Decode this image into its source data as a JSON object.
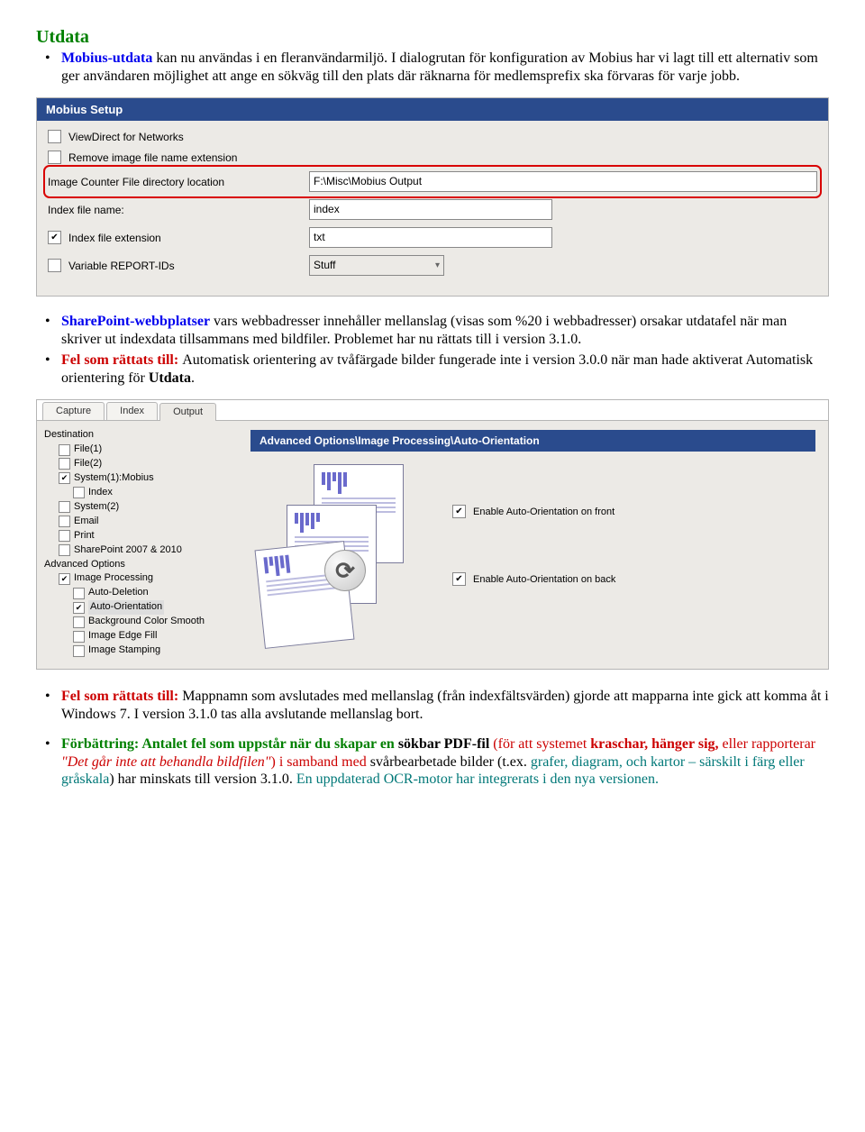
{
  "heading": "Utdata",
  "para1": {
    "p1a": "Mobius-utdata",
    "p1b": " kan nu användas i en fleranvändarmiljö. I dialogrutan för konfiguration av Mobius har vi lagt till ett alternativ som ger användaren möjlighet att ange en sökväg till den plats där räknarna för medlemsprefix ska förvaras för varje jobb."
  },
  "mobius": {
    "title": "Mobius Setup",
    "row1": "ViewDirect for Networks",
    "row2": "Remove image file name extension",
    "row3_label": "Image Counter File directory location",
    "row3_value": "F:\\Misc\\Mobius Output",
    "row4_label": "Index file name:",
    "row4_value": "index",
    "row5_label": "Index file extension",
    "row5_value": "txt",
    "row6_label": "Variable REPORT-IDs",
    "row6_value": "Stuff"
  },
  "para2": {
    "p2a": "SharePoint-webbplatser",
    "p2b": " vars webbadresser innehåller mellanslag (visas som %20 i webbadresser) orsakar utdatafel när man skriver ut indexdata tillsammans med bildfiler. Problemet har nu rättats till i version 3.1.0."
  },
  "para3": {
    "p3a": "Fel som rättats till: ",
    "p3b": "Automatisk orientering av tvåfärgade bilder fungerade inte i version 3.0.0 när man hade aktiverat Automatisk orientering för ",
    "p3c": "Utdata",
    "p3d": "."
  },
  "out": {
    "tab1": "Capture",
    "tab2": "Index",
    "tab3": "Output",
    "tree": {
      "dest": "Destination",
      "file1": "File(1)",
      "file2": "File(2)",
      "sys1": "System(1):Mobius",
      "sys1_index": "Index",
      "sys2": "System(2)",
      "email": "Email",
      "print": "Print",
      "sp": "SharePoint 2007 & 2010",
      "adv": "Advanced Options",
      "imgproc": "Image Processing",
      "autodel": "Auto-Deletion",
      "autoori": "Auto-Orientation",
      "bgc": "Background Color Smooth",
      "edge": "Image Edge Fill",
      "stamp": "Image Stamping"
    },
    "pane_title": "Advanced Options\\Image Processing\\Auto-Orientation",
    "chk_front": "Enable Auto-Orientation on front",
    "chk_back": "Enable Auto-Orientation on back",
    "rot": "⟳"
  },
  "para4": {
    "p4a": "Fel som rättats till: ",
    "p4b": "Mappnamn som avslutades med mellanslag (från indexfältsvärden) gjorde att mapparna inte gick att komma åt i Windows 7. I version 3.1.0 tas alla avslutande mellanslag bort."
  },
  "para5": {
    "p5a": "Förbättring: Antalet fel som uppstår när du skapar en ",
    "p5b": "sökbar PDF-fil",
    "p5c": "  (för att systemet ",
    "p5d": "kraschar, hänger sig,",
    "p5e": " eller rapporterar ",
    "p5f": "\"Det går inte att behandla bildfilen\"",
    "p5g": ") i samband med ",
    "p5h": "svårbearbetade bilder (t.ex. ",
    "p5i": "grafer, diagram, och kartor – särskilt i färg eller gråskala",
    "p5j": ") har minskats till version 3.1.0. ",
    "p5k": "En uppdaterad OCR-motor har integrerats i den nya versionen."
  }
}
